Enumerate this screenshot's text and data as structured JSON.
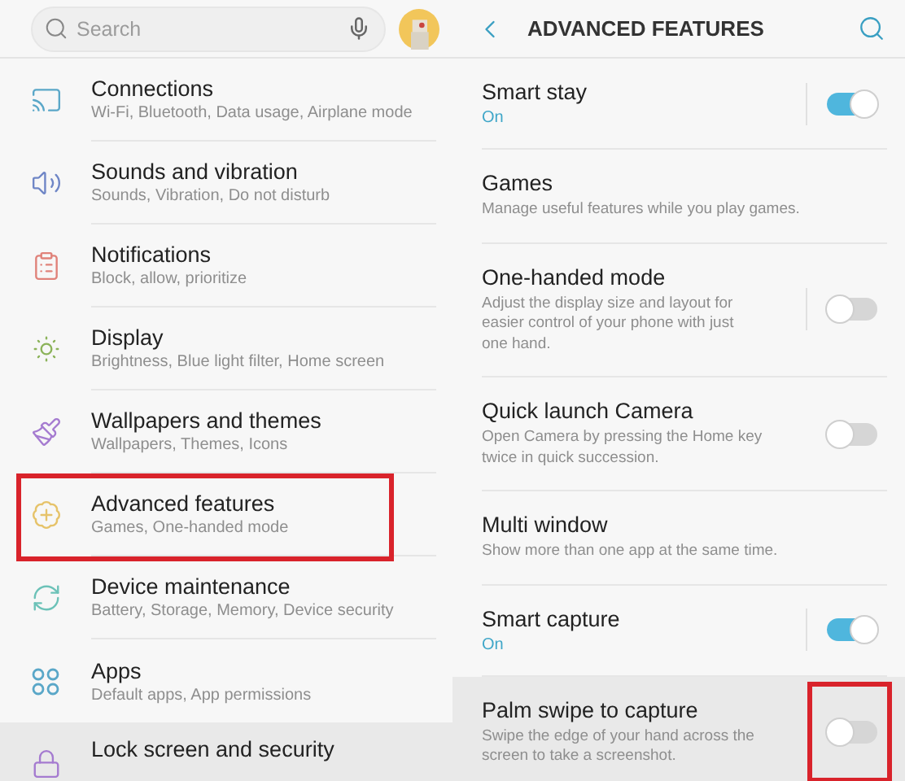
{
  "search": {
    "placeholder": "Search"
  },
  "settings": [
    {
      "title": "Connections",
      "summary": "Wi-Fi, Bluetooth, Data usage, Airplane mode",
      "color": "#5aa7c8",
      "highlighted": false,
      "pressed": false
    },
    {
      "title": "Sounds and vibration",
      "summary": "Sounds, Vibration, Do not disturb",
      "color": "#6f86c6",
      "highlighted": false,
      "pressed": false
    },
    {
      "title": "Notifications",
      "summary": "Block, allow, prioritize",
      "color": "#e0827a",
      "highlighted": false,
      "pressed": false
    },
    {
      "title": "Display",
      "summary": "Brightness, Blue light filter, Home screen",
      "color": "#8cb35a",
      "highlighted": false,
      "pressed": false
    },
    {
      "title": "Wallpapers and themes",
      "summary": "Wallpapers, Themes, Icons",
      "color": "#a57bd0",
      "highlighted": false,
      "pressed": false
    },
    {
      "title": "Advanced features",
      "summary": "Games, One-handed mode",
      "color": "#e6c36a",
      "highlighted": true,
      "pressed": false
    },
    {
      "title": "Device maintenance",
      "summary": "Battery, Storage, Memory, Device security",
      "color": "#6cc2b8",
      "highlighted": false,
      "pressed": false
    },
    {
      "title": "Apps",
      "summary": "Default apps, App permissions",
      "color": "#5aa7c8",
      "highlighted": false,
      "pressed": false
    },
    {
      "title": "Lock screen and security",
      "color": "#a57bd0",
      "highlighted": false,
      "pressed": true
    }
  ],
  "detail": {
    "title": "ADVANCED FEATURES",
    "rows": [
      {
        "kind": "toggle",
        "title": "Smart stay",
        "status": "On",
        "on": true,
        "split": true,
        "pressed": false,
        "highlighted": false
      },
      {
        "kind": "plain",
        "title": "Games",
        "summary": "Manage useful features while you play games.",
        "pressed": false
      },
      {
        "kind": "toggle",
        "title": "One-handed mode",
        "summary": "Adjust the display size and layout for easier control of your phone with just one hand.",
        "on": false,
        "split": true,
        "pressed": false,
        "highlighted": false
      },
      {
        "kind": "toggle",
        "title": "Quick launch Camera",
        "summary": "Open Camera by pressing the Home key twice in quick succession.",
        "on": false,
        "split": false,
        "pressed": false,
        "highlighted": false
      },
      {
        "kind": "plain",
        "title": "Multi window",
        "summary": "Show more than one app at the same time.",
        "pressed": false
      },
      {
        "kind": "toggle",
        "title": "Smart capture",
        "status": "On",
        "on": true,
        "split": true,
        "pressed": false,
        "highlighted": false
      },
      {
        "kind": "toggle",
        "title": "Palm swipe to capture",
        "summary": "Swipe the edge of your hand across the screen to take a screenshot.",
        "on": false,
        "split": false,
        "pressed": true,
        "highlighted": true
      }
    ]
  }
}
